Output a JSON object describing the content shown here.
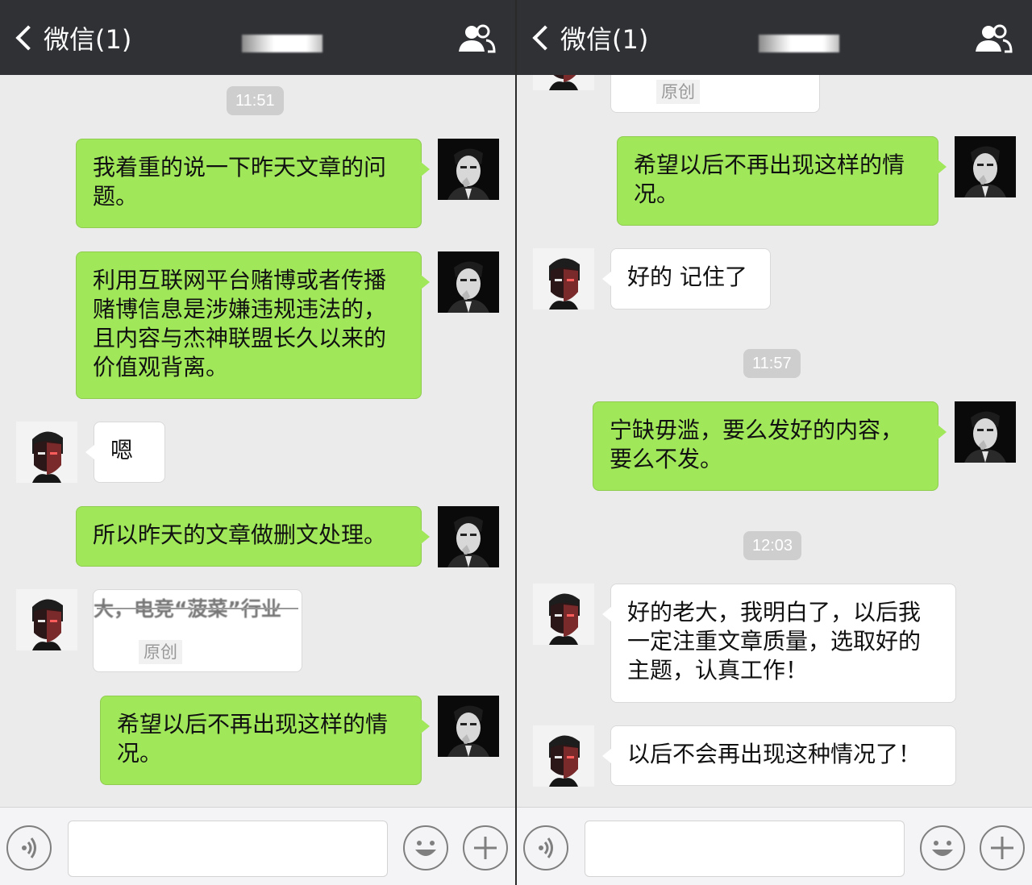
{
  "left": {
    "header": {
      "back_label": "微信(1)"
    },
    "timestamps": [
      "11:51"
    ],
    "messages": [
      {
        "sender": "me",
        "text": "我着重的说一下昨天文章的问题。"
      },
      {
        "sender": "me",
        "text": "利用互联网平台赌博或者传播赌博信息是涉嫌违规违法的，且内容与杰神联盟长久以来的价值观背离。"
      },
      {
        "sender": "friend",
        "text": "嗯"
      },
      {
        "sender": "me",
        "text": "所以昨天的文章做删文处理。"
      },
      {
        "sender": "friend",
        "type": "article_card",
        "title": "大，电竞“菠菜”行业",
        "tag": "原创"
      },
      {
        "sender": "me",
        "text": "希望以后不再出现这样的情况。"
      }
    ]
  },
  "right": {
    "header": {
      "back_label": "微信(1)"
    },
    "timestamps": [
      "11:57",
      "12:03"
    ],
    "messages": [
      {
        "sender": "friend",
        "type": "article_card",
        "tag": "原创"
      },
      {
        "sender": "me",
        "text": "希望以后不再出现这样的情况。"
      },
      {
        "sender": "friend",
        "text": "好的 记住了"
      },
      {
        "sender": "me",
        "text": "宁缺毋滥，要么发好的内容，要么不发。"
      },
      {
        "sender": "friend",
        "text": "好的老大，我明白了，以后我一定注重文章质量，选取好的主题，认真工作！"
      },
      {
        "sender": "friend",
        "text": "以后不会再出现这种情况了！"
      }
    ]
  },
  "icons": {
    "back": "chevron-left-icon",
    "chat_info": "people-icon",
    "voice": "voice-icon",
    "emoji": "emoji-icon",
    "more": "plus-icon"
  },
  "colors": {
    "header_bg": "#2f3135",
    "chat_bg": "#ebebeb",
    "sent_bubble": "#a0e75a",
    "received_bubble": "#ffffff",
    "timestamp_bg": "#cecece"
  }
}
